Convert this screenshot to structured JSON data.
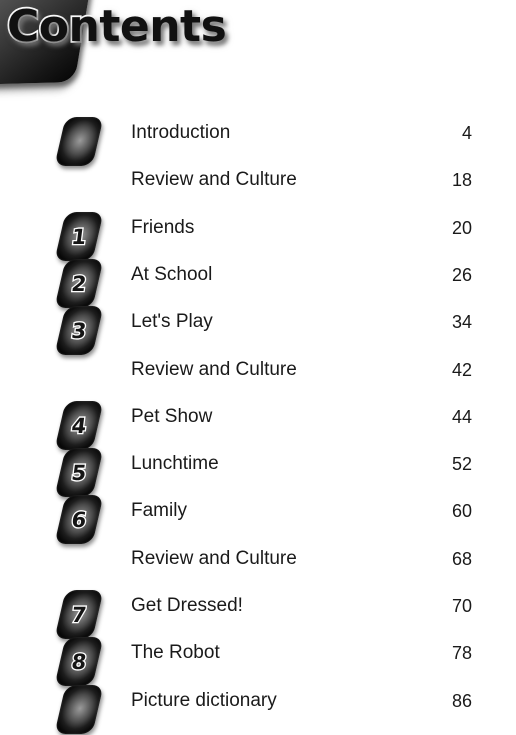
{
  "page": {
    "title": "Contents",
    "background_color": "#ffffff",
    "text_color": "#1a1a1a",
    "badge_color": "#1d1d1d"
  },
  "contents": {
    "rows": [
      {
        "badge": "",
        "has_badge": true,
        "label": "Introduction",
        "page": "4"
      },
      {
        "badge": "",
        "has_badge": false,
        "label": "Review and Culture",
        "page": "18"
      },
      {
        "badge": "1",
        "has_badge": true,
        "label": "Friends",
        "page": "20"
      },
      {
        "badge": "2",
        "has_badge": true,
        "label": "At School",
        "page": "26"
      },
      {
        "badge": "3",
        "has_badge": true,
        "label": "Let's Play",
        "page": "34"
      },
      {
        "badge": "",
        "has_badge": false,
        "label": "Review and Culture",
        "page": "42"
      },
      {
        "badge": "4",
        "has_badge": true,
        "label": "Pet Show",
        "page": "44"
      },
      {
        "badge": "5",
        "has_badge": true,
        "label": "Lunchtime",
        "page": "52"
      },
      {
        "badge": "6",
        "has_badge": true,
        "label": "Family",
        "page": "60"
      },
      {
        "badge": "",
        "has_badge": false,
        "label": "Review and Culture",
        "page": "68"
      },
      {
        "badge": "7",
        "has_badge": true,
        "label": "Get Dressed!",
        "page": "70"
      },
      {
        "badge": "8",
        "has_badge": true,
        "label": "The Robot",
        "page": "78"
      },
      {
        "badge": "",
        "has_badge": true,
        "label": "Picture dictionary",
        "page": "86"
      }
    ]
  }
}
